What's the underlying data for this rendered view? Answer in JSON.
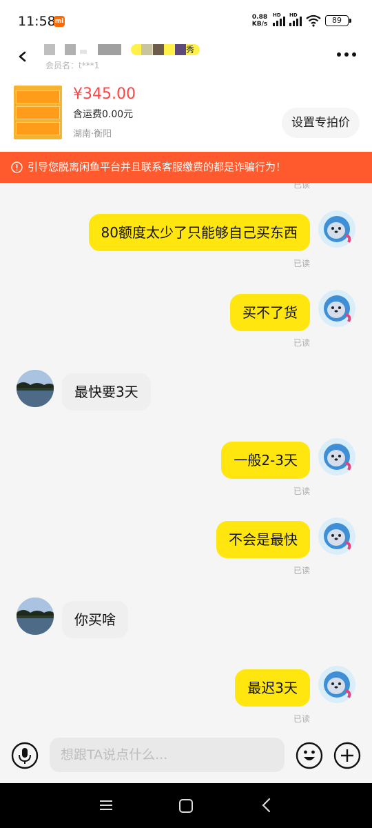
{
  "status_bar": {
    "time": "11:58",
    "net_speed_value": "0.88",
    "net_speed_unit": "KB/s",
    "signal_label": "HD",
    "battery": "89"
  },
  "header": {
    "seller_badge": "秀",
    "member_label": "会员名：t***1"
  },
  "product": {
    "price": "¥345.00",
    "shipping": "含运费0.00元",
    "location": "湖南·衡阳",
    "set_price_button": "设置专拍价"
  },
  "warning": {
    "text": "引导您脱离闲鱼平台并且联系客服缴费的都是诈骗行为！"
  },
  "chat": {
    "read_label": "已读",
    "messages": [
      {
        "sender": "me",
        "text": "80额度太少了只能够自己买东西",
        "read": "已读"
      },
      {
        "sender": "me",
        "text": "买不了货",
        "read": "已读"
      },
      {
        "sender": "them",
        "text": "最快要3天"
      },
      {
        "sender": "me",
        "text": "一般2-3天",
        "read": "已读"
      },
      {
        "sender": "me",
        "text": "不会是最快",
        "read": "已读"
      },
      {
        "sender": "them",
        "text": "你买啥"
      },
      {
        "sender": "me",
        "text": "最迟3天",
        "read": "已读"
      }
    ]
  },
  "input_bar": {
    "placeholder": "想跟TA说点什么..."
  },
  "colors": {
    "accent_yellow": "#ffe60f",
    "price_red": "#ff4444",
    "warning_bg": "#ff5a2e"
  }
}
